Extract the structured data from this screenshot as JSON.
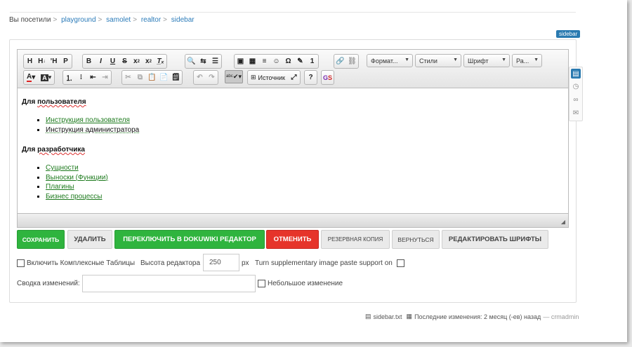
{
  "breadcrumbs": {
    "prefix": "Вы посетили",
    "items": [
      "playground",
      "samolet",
      "realtor",
      "sidebar"
    ]
  },
  "page_badge": "sidebar",
  "toolbar": {
    "format_combo": "Формат...",
    "styles_combo": "Стили",
    "font_combo": "Шрифт",
    "size_combo": "Ра...",
    "source_label": "Источник",
    "help_label": "?"
  },
  "content": {
    "heading_user_prefix": "Для",
    "heading_user_word": "пользователя",
    "user_links": [
      "Инструкция пользователя",
      "Инструкция администратора"
    ],
    "heading_dev_prefix": "Для",
    "heading_dev_word": "разработчика",
    "dev_links": [
      "Сущности",
      "Выноски (Функции)",
      "Плагины",
      "Бизнес процессы"
    ]
  },
  "buttons": {
    "save": "Сохранить",
    "delete": "Удалить",
    "switch": "Переключить в DokuWiki редактор",
    "cancel": "Отменить",
    "backup": "Резервная копия",
    "revert": "Вернуться",
    "edit_fonts": "Редактировать шрифты"
  },
  "options": {
    "complex_tables": "Включить Комплексные Таблицы",
    "editor_height_label": "Высота редактора",
    "editor_height_value": "250",
    "editor_height_unit": "px",
    "paste_support": "Turn supplementary image paste support on",
    "summary_label": "Сводка изменений:",
    "summary_value": "",
    "minor_change": "Небольшое изменение"
  },
  "footer": {
    "file": "sidebar.txt",
    "last_changed": "Последние изменения: 2 месяц (-ев) назад",
    "author": "— crmadmin"
  },
  "colors": {
    "green": "#2fb43e",
    "red": "#e6342a",
    "link": "#2b7bb9",
    "accent": "#2a7ab0"
  }
}
